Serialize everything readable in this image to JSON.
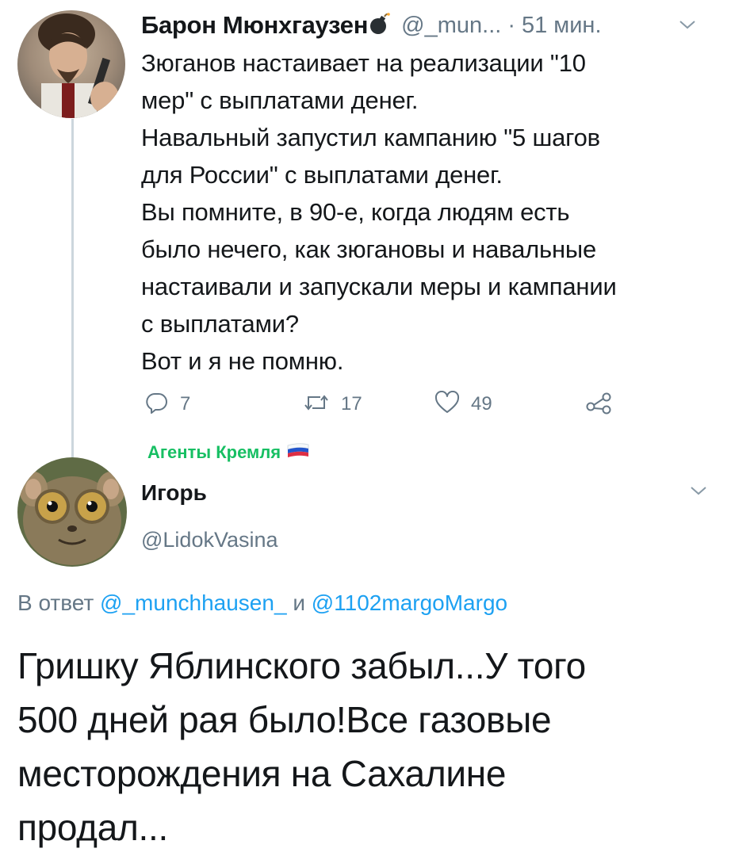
{
  "tweet": {
    "author_name": "Барон Мюнхгаузен",
    "author_handle": "@_mun...",
    "separator": "·",
    "time": "51 мин.",
    "text_lines": [
      "Зюганов настаивает на реализации \"10",
      "мер\" с выплатами денег.",
      "Навальный запустил кампанию \"5 шагов",
      "для России\" с выплатами денег.",
      "Вы помните, в 90-е, когда людям есть",
      "было нечего, как зюгановы и навальные",
      "настаивали и запускали меры и кампании",
      "с выплатами?",
      "Вот и я не помню."
    ],
    "actions": {
      "replies": "7",
      "retweets": "17",
      "likes": "49"
    }
  },
  "group_label": "Агенты Кремля",
  "reply": {
    "author_name": "Игорь",
    "author_handle": "@LidokVasina",
    "reply_prefix": "В ответ",
    "reply_user1": "@_munchhausen_",
    "reply_and": "и",
    "reply_user2": "@1102margoMargo",
    "text_lines": [
      "Гришку Яблинского забыл...У того",
      "500 дней рая было!Все газовые",
      "месторождения на Сахалине",
      "продал..."
    ]
  },
  "colors": {
    "text": "#14171a",
    "secondary": "#657786",
    "link": "#1da1f2",
    "group": "#17bf63",
    "thread_line": "#ccd6dd"
  }
}
